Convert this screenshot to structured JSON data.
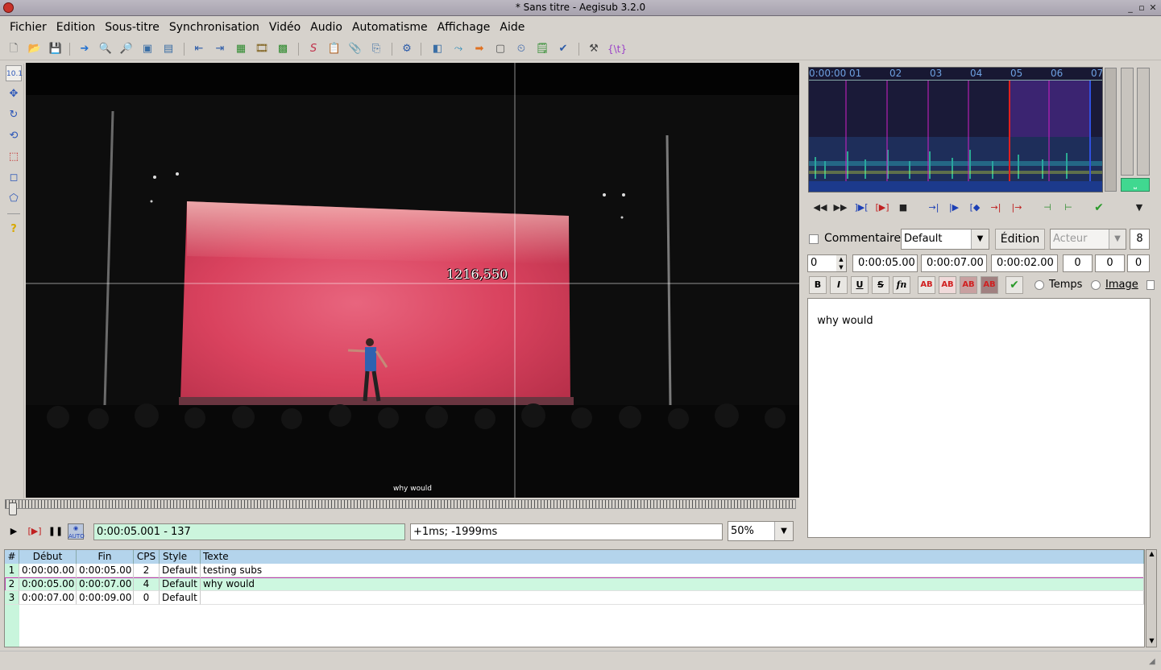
{
  "window": {
    "title": "* Sans titre - Aegisub 3.2.0"
  },
  "menu": [
    "Fichier",
    "Edition",
    "Sous-titre",
    "Synchronisation",
    "Vidéo",
    "Audio",
    "Automatisme",
    "Affichage",
    "Aide"
  ],
  "video": {
    "crosshair_text": "1216,550",
    "subtitle_text": "why would",
    "time_display": "0:00:05.001 - 137",
    "offset_display": "+1ms; -1999ms",
    "zoom": "50%"
  },
  "audio": {
    "timeline_labels": [
      "0:00:00",
      "01",
      "02",
      "03",
      "04",
      "05",
      "06",
      "07"
    ]
  },
  "edit": {
    "comment_label": "Commentaire",
    "style": "Default",
    "edit_button": "Édition",
    "actor_placeholder": "Acteur",
    "line_count": "8",
    "layer": "0",
    "start": "0:00:05.00",
    "end": "0:00:07.00",
    "duration": "0:00:02.00",
    "margin_l": "0",
    "margin_r": "0",
    "margin_v": "0",
    "time_radio": "Temps",
    "image_radio": "Image",
    "text": "why would",
    "format_buttons": {
      "bold": "B",
      "italic": "I",
      "underline": "U",
      "strike": "S",
      "font": "fn",
      "color": "AB"
    }
  },
  "grid": {
    "headers": [
      "#",
      "Début",
      "Fin",
      "CPS",
      "Style",
      "Texte"
    ],
    "rows": [
      {
        "n": "1",
        "start": "0:00:00.00",
        "end": "0:00:05.00",
        "cps": "2",
        "style": "Default",
        "text": "testing subs"
      },
      {
        "n": "2",
        "start": "0:00:05.00",
        "end": "0:00:07.00",
        "cps": "4",
        "style": "Default",
        "text": "why would"
      },
      {
        "n": "3",
        "start": "0:00:07.00",
        "end": "0:00:09.00",
        "cps": "0",
        "style": "Default",
        "text": ""
      }
    ]
  },
  "colors": {
    "selected_row": "#cdf7e0",
    "accent": "#c8ee2a",
    "audio_bg": "#181833"
  }
}
